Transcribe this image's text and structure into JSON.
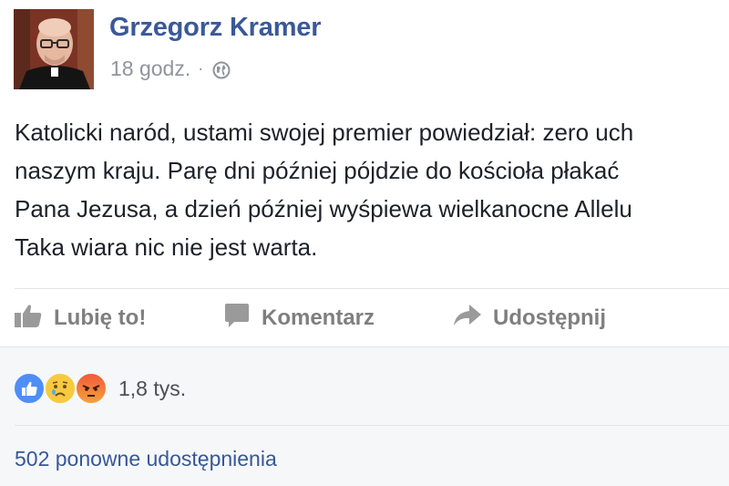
{
  "post": {
    "author": "Grzegorz Kramer",
    "time": "18 godz.",
    "separator": "·",
    "privacy_icon": "globe-icon",
    "text_lines": [
      "Katolicki naród, ustami swojej premier powiedział: zero uch",
      "naszym kraju. Parę dni później pójdzie do kościoła płakać",
      "Pana Jezusa, a dzień później wyśpiewa wielkanocne Allelu",
      "Taka wiara nic nie jest warta."
    ]
  },
  "actions": {
    "like_label": "Lubię to!",
    "like_icon": "thumbs-up-icon",
    "comment_label": "Komentarz",
    "comment_icon": "speech-bubble-icon",
    "share_label": "Udostępnij",
    "share_icon": "share-arrow-icon"
  },
  "reactions": {
    "icons": [
      "like-reaction-icon",
      "sad-reaction-icon",
      "angry-reaction-icon"
    ],
    "count": "1,8 tys."
  },
  "shares": {
    "label": "502 ponowne udostępnienia"
  },
  "colors": {
    "author_link": "#3b5998",
    "meta_text": "#90949c",
    "body_text": "#1d2129",
    "action_text": "#7f7f7f",
    "footer_bg": "#f6f7f9",
    "share_link": "#365899"
  }
}
